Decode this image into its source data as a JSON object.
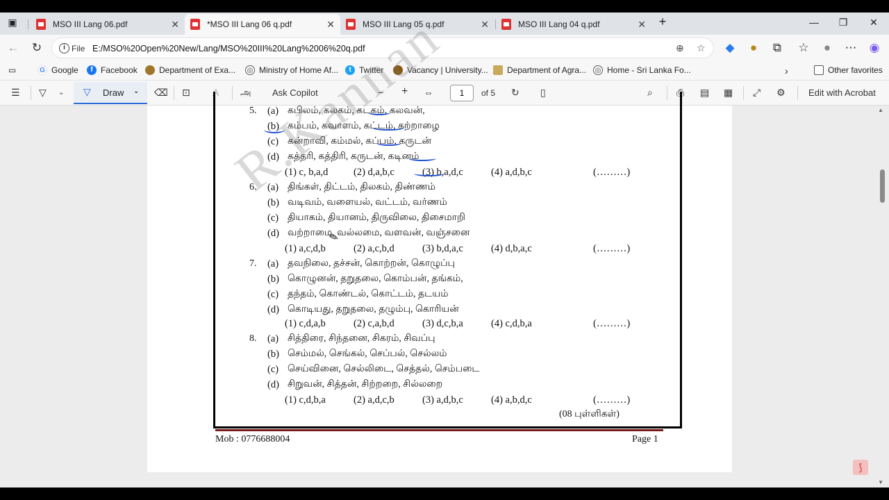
{
  "tabs": [
    {
      "title": "MSO III Lang 06.pdf",
      "active": false
    },
    {
      "title": "*MSO III Lang 06 q.pdf",
      "active": true
    },
    {
      "title": "MSO III Lang 05 q.pdf",
      "active": false
    },
    {
      "title": "MSO III Lang 04 q.pdf",
      "active": false
    }
  ],
  "address": {
    "scheme": "File",
    "url": "E:/MSO%20Open%20New/Lang/MSO%20III%20Lang%2006%20q.pdf"
  },
  "favorites": [
    {
      "label": "Google"
    },
    {
      "label": "Facebook"
    },
    {
      "label": "Department of Exa..."
    },
    {
      "label": "Ministry of Home Af..."
    },
    {
      "label": "Twitter"
    },
    {
      "label": "Vacancy | University..."
    },
    {
      "label": "Department of Agra..."
    },
    {
      "label": "Home - Sri Lanka Fo..."
    },
    {
      "label": "Other favorites"
    }
  ],
  "pdf_toolbar": {
    "draw_label": "Draw",
    "copilot_label": "Ask Copilot",
    "page_current": "1",
    "page_total": "of 5",
    "edit_acrobat": "Edit with Acrobat"
  },
  "document": {
    "watermark": "R.Kannan",
    "questions": [
      {
        "num": "5.",
        "options": [
          {
            "letter": "(a)",
            "text": "கபிலம், கலகம், கடகம், கலவன்,"
          },
          {
            "letter": "(b)",
            "text": "கம்பம், கவாளம், கட்டம், கற்றாழை"
          },
          {
            "letter": "(c)",
            "text": "கன்றாவி, கம்மல், கப்பம், கருடன்"
          },
          {
            "letter": "(d)",
            "text": "கத்தரி, கத்திரி, கருடன், கடினம்"
          }
        ],
        "answers": [
          "(1) c, b,a,d",
          "(2) d,a,b,c",
          "(3) b,a,d,c",
          "(4) a,d,b,c"
        ],
        "blank": "(………)"
      },
      {
        "num": "6.",
        "options": [
          {
            "letter": "(a)",
            "text": "திங்கள், திட்டம், திலகம், திண்ணம்"
          },
          {
            "letter": "(b)",
            "text": "வடிவம், வளையல், வட்டம், வர்ணம்"
          },
          {
            "letter": "(c)",
            "text": "தியாகம், தியானம், திருவிலை, திசைமாறி"
          },
          {
            "letter": "(d)",
            "text": "வற்றாமை, வல்லமை, வளவன், வஞ்சனை"
          }
        ],
        "answers": [
          "(1) a,c,d,b",
          "(2) a,c,b,d",
          "(3) b,d,a,c",
          "(4) d,b,a,c"
        ],
        "blank": "(………)"
      },
      {
        "num": "7.",
        "options": [
          {
            "letter": "(a)",
            "text": "தவநிலை, தச்சன், கொற்றன், கொழுப்பு"
          },
          {
            "letter": "(b)",
            "text": "கொழுனன், தறுதலை, கொம்பன், தங்கம்,"
          },
          {
            "letter": "(c)",
            "text": "தந்தம், கொண்டல், கொட்டம், தடயம்"
          },
          {
            "letter": "(d)",
            "text": "கொடியது, தறுதலை, தழும்பு, கொரியன்"
          }
        ],
        "answers": [
          "(1) c,d,a,b",
          "(2) c,a,b,d",
          "(3) d,c,b,a",
          "(4) c,d,b,a"
        ],
        "blank": "(………)"
      },
      {
        "num": "8.",
        "options": [
          {
            "letter": "(a)",
            "text": "சித்திரை, சிந்தனை, சிகரம், சிவப்பு"
          },
          {
            "letter": "(b)",
            "text": "செம்மல், செங்கல், செப்பல், செல்லம்"
          },
          {
            "letter": "(c)",
            "text": "செய்வினை, செல்லிடை, செத்தல், செம்படை"
          },
          {
            "letter": "(d)",
            "text": "சிறுவன், சித்தன், சிற்றறை, சில்லறை"
          }
        ],
        "answers": [
          "(1) c,d,b,a",
          "(2) a,d,c,b",
          "(3) a,d,b,c",
          "(4) a,b,d,c"
        ],
        "blank": "(………)"
      }
    ],
    "marks": "(08  புள்ளிகள்)",
    "footer_left": "Mob : 0776688004",
    "footer_right": "Page 1"
  }
}
